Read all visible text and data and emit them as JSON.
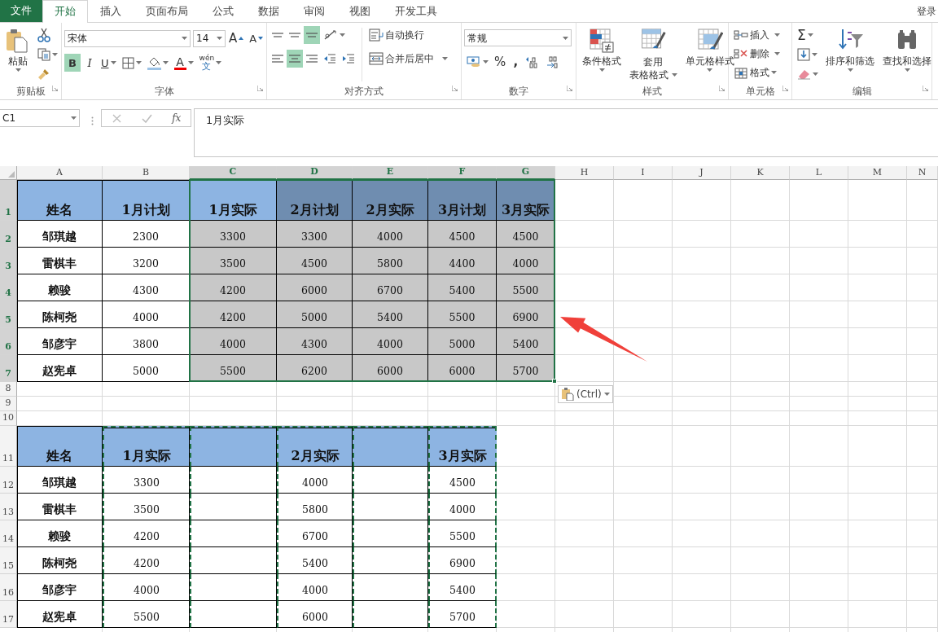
{
  "tabs": [
    {
      "label": "文件",
      "kind": "file",
      "selected": false
    },
    {
      "label": "开始",
      "kind": "tab",
      "selected": true
    },
    {
      "label": "插入",
      "kind": "tab",
      "selected": false
    },
    {
      "label": "页面布局",
      "kind": "tab",
      "selected": false
    },
    {
      "label": "公式",
      "kind": "tab",
      "selected": false
    },
    {
      "label": "数据",
      "kind": "tab",
      "selected": false
    },
    {
      "label": "审阅",
      "kind": "tab",
      "selected": false
    },
    {
      "label": "视图",
      "kind": "tab",
      "selected": false
    },
    {
      "label": "开发工具",
      "kind": "tab",
      "selected": false
    }
  ],
  "account": "登录",
  "ribbon": {
    "clipboard": {
      "label": "剪贴板",
      "paste": "粘贴"
    },
    "font": {
      "label": "字体",
      "name": "宋体",
      "size": "14",
      "grow": "A",
      "shrink": "A",
      "bold": {
        "label": "B",
        "selected": true
      },
      "italic": {
        "label": "I",
        "selected": false
      },
      "underline": {
        "label": "U",
        "selected": false
      },
      "font_color": "A",
      "phonetic": {
        "top": "wén",
        "bottom": "文"
      }
    },
    "alignment": {
      "label": "对齐方式",
      "top": {
        "selected": false
      },
      "middle": {
        "selected": false
      },
      "bottom": {
        "selected": true
      },
      "left": {
        "selected": false
      },
      "center": {
        "selected": true
      },
      "right": {
        "selected": false
      },
      "wrap": "自动换行",
      "merge": "合并后居中"
    },
    "number": {
      "label": "数字",
      "format": "常规",
      "percent": "%",
      "comma": ","
    },
    "styles": {
      "label": "样式",
      "conditional": "条件格式",
      "table_top": "套用",
      "table_bottom": "表格格式",
      "cell_styles": "单元格样式"
    },
    "cells": {
      "label": "单元格",
      "insert": "插入",
      "delete": "删除",
      "format": "格式"
    },
    "editing": {
      "label": "编辑",
      "autosum": "Σ",
      "sort": "排序和筛选",
      "find": "查找和选择"
    }
  },
  "formula_bar": {
    "name_box": "C1",
    "fx": "fx",
    "content": "1月实际"
  },
  "sheet": {
    "columns": [
      {
        "label": "A",
        "selected": false
      },
      {
        "label": "B",
        "selected": false
      },
      {
        "label": "C",
        "selected": true
      },
      {
        "label": "D",
        "selected": true
      },
      {
        "label": "E",
        "selected": true
      },
      {
        "label": "F",
        "selected": true
      },
      {
        "label": "G",
        "selected": true
      },
      {
        "label": "H",
        "selected": false
      },
      {
        "label": "I",
        "selected": false
      },
      {
        "label": "J",
        "selected": false
      },
      {
        "label": "K",
        "selected": false
      },
      {
        "label": "L",
        "selected": false
      },
      {
        "label": "M",
        "selected": false
      },
      {
        "label": "N",
        "selected": false
      }
    ],
    "rows": [
      {
        "label": "1",
        "kind": "header",
        "selected": true,
        "cells": [
          "姓名",
          "1月计划",
          "1月实际",
          "2月计划",
          "2月实际",
          "3月计划",
          "3月实际"
        ]
      },
      {
        "label": "2",
        "kind": "data",
        "selected": true,
        "cells": [
          "邹琪越",
          "2300",
          "3300",
          "3300",
          "4000",
          "4500",
          "4500"
        ]
      },
      {
        "label": "3",
        "kind": "data",
        "selected": true,
        "cells": [
          "雷棋丰",
          "3200",
          "3500",
          "4500",
          "5800",
          "4400",
          "4000"
        ]
      },
      {
        "label": "4",
        "kind": "data",
        "selected": true,
        "cells": [
          "赖骏",
          "4300",
          "4200",
          "6000",
          "6700",
          "5400",
          "5500"
        ]
      },
      {
        "label": "5",
        "kind": "data",
        "selected": true,
        "cells": [
          "陈柯尧",
          "4000",
          "4200",
          "5000",
          "5400",
          "5500",
          "6900"
        ]
      },
      {
        "label": "6",
        "kind": "data",
        "selected": true,
        "cells": [
          "邹彦宇",
          "3800",
          "4000",
          "4300",
          "4000",
          "5000",
          "5400"
        ]
      },
      {
        "label": "7",
        "kind": "data",
        "selected": true,
        "cells": [
          "赵宪卓",
          "5000",
          "5500",
          "6200",
          "6000",
          "6000",
          "5700"
        ]
      },
      {
        "label": "8",
        "kind": "blank",
        "selected": false
      },
      {
        "label": "9",
        "kind": "blank",
        "selected": false
      },
      {
        "label": "10",
        "kind": "blank",
        "selected": false
      },
      {
        "label": "11",
        "kind": "header",
        "selected": false,
        "cells": [
          {
            "text": "姓名",
            "copied": false
          },
          {
            "text": "1月实际",
            "copied": true
          },
          {
            "copied": true
          },
          {
            "text": "2月实际",
            "copied": true
          },
          {
            "copied": true
          },
          {
            "text": "3月实际",
            "copied": true
          }
        ]
      },
      {
        "label": "12",
        "kind": "data",
        "selected": false,
        "cells": [
          {
            "text": "邹琪越",
            "copied": false
          },
          {
            "text": "3300",
            "copied": true
          },
          {
            "copied": true
          },
          {
            "text": "4000",
            "copied": true
          },
          {
            "copied": true
          },
          {
            "text": "4500",
            "copied": true
          }
        ]
      },
      {
        "label": "13",
        "kind": "data",
        "selected": false,
        "cells": [
          {
            "text": "雷棋丰",
            "copied": false
          },
          {
            "text": "3500",
            "copied": true
          },
          {
            "copied": true
          },
          {
            "text": "5800",
            "copied": true
          },
          {
            "copied": true
          },
          {
            "text": "4000",
            "copied": true
          }
        ]
      },
      {
        "label": "14",
        "kind": "data",
        "selected": false,
        "cells": [
          {
            "text": "赖骏",
            "copied": false
          },
          {
            "text": "4200",
            "copied": true
          },
          {
            "copied": true
          },
          {
            "text": "6700",
            "copied": true
          },
          {
            "copied": true
          },
          {
            "text": "5500",
            "copied": true
          }
        ]
      },
      {
        "label": "15",
        "kind": "data",
        "selected": false,
        "cells": [
          {
            "text": "陈柯尧",
            "copied": false
          },
          {
            "text": "4200",
            "copied": true
          },
          {
            "copied": true
          },
          {
            "text": "5400",
            "copied": true
          },
          {
            "copied": true
          },
          {
            "text": "6900",
            "copied": true
          }
        ]
      },
      {
        "label": "16",
        "kind": "data",
        "selected": false,
        "cells": [
          {
            "text": "邹彦宇",
            "copied": false
          },
          {
            "text": "4000",
            "copied": true
          },
          {
            "copied": true
          },
          {
            "text": "4000",
            "copied": true
          },
          {
            "copied": true
          },
          {
            "text": "5400",
            "copied": true
          }
        ]
      },
      {
        "label": "17",
        "kind": "data",
        "selected": false,
        "cells": [
          {
            "text": "赵宪卓",
            "copied": false
          },
          {
            "text": "5500",
            "copied": true
          },
          {
            "copied": true
          },
          {
            "text": "6000",
            "copied": true
          },
          {
            "copied": true
          },
          {
            "text": "5700",
            "copied": true
          }
        ]
      }
    ]
  },
  "paste_options": {
    "label": "(Ctrl)"
  },
  "annotation": {
    "kind": "arrow"
  }
}
